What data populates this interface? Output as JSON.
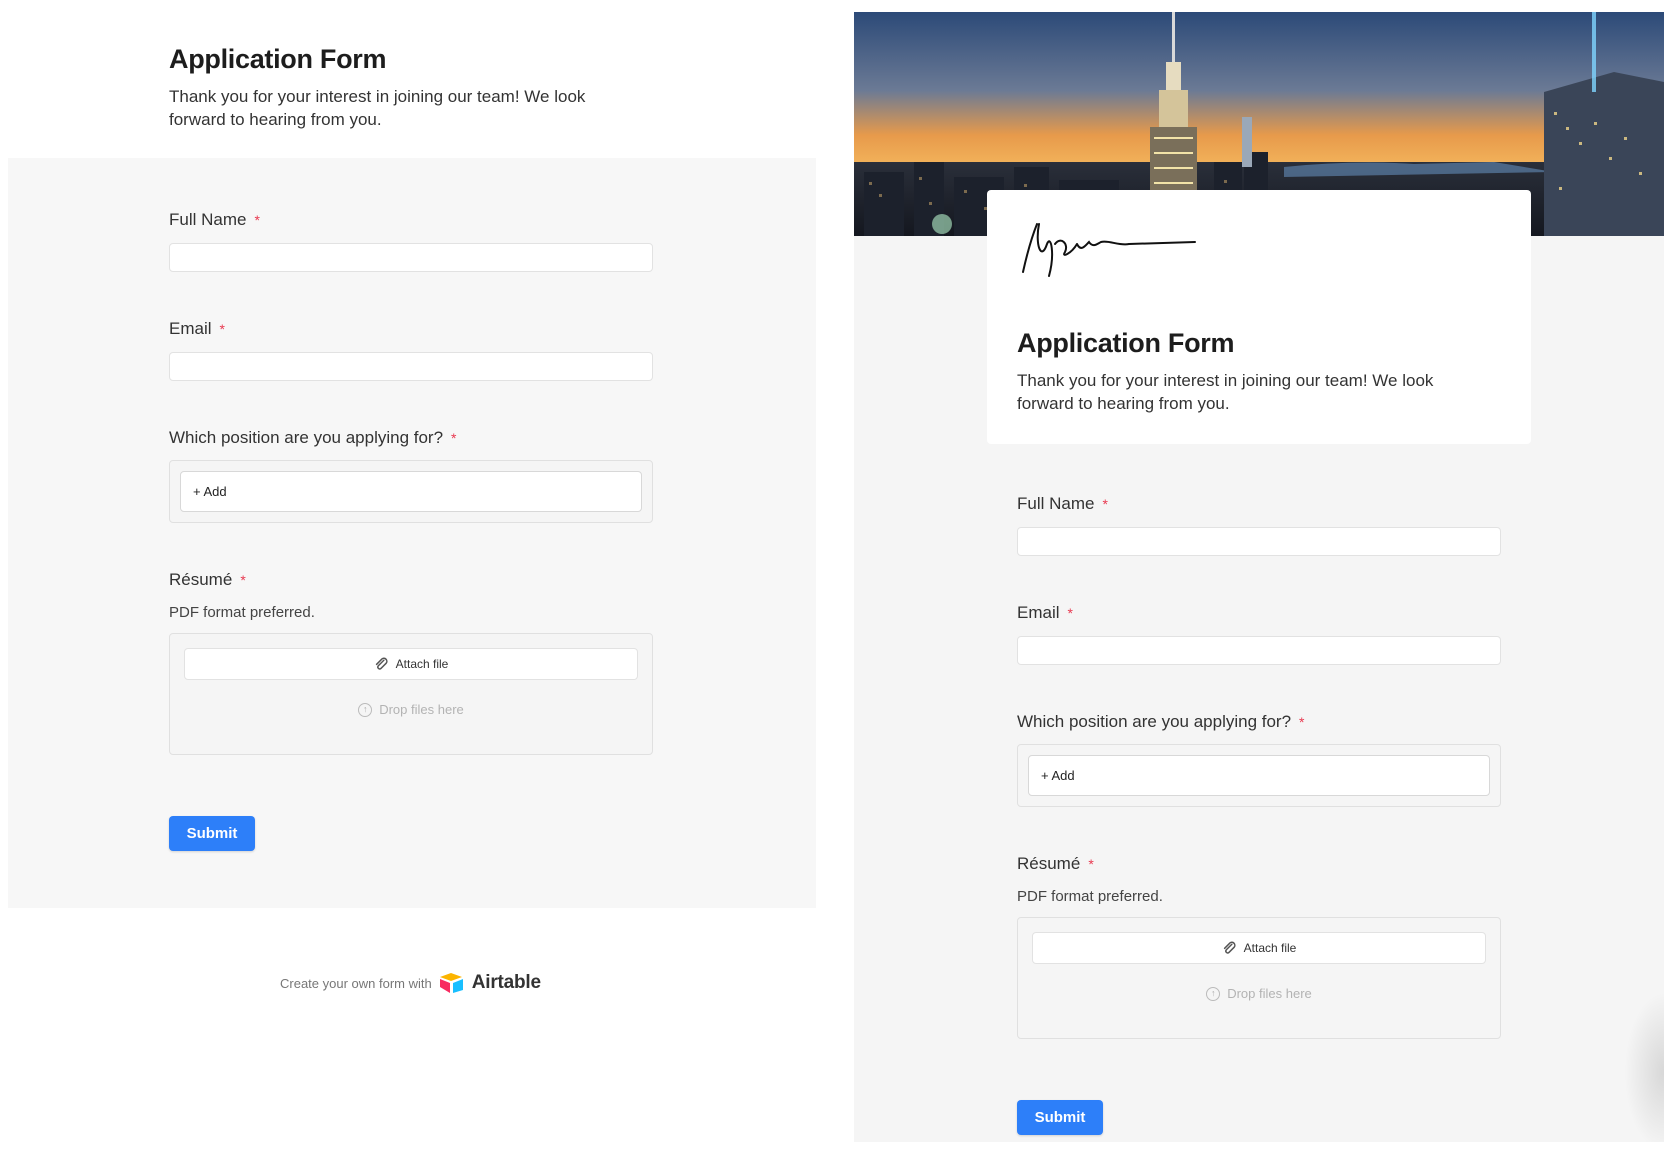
{
  "form": {
    "title": "Application Form",
    "description": "Thank you for your interest in joining our team! We look forward to hearing from you.",
    "fields": {
      "full_name": {
        "label": "Full Name",
        "required_mark": "*",
        "value": ""
      },
      "email": {
        "label": "Email",
        "required_mark": "*",
        "value": ""
      },
      "position": {
        "label": "Which position are you applying for?",
        "required_mark": "*",
        "add_label": "+ Add"
      },
      "resume": {
        "label": "Résumé",
        "required_mark": "*",
        "hint": "PDF format preferred.",
        "attach_label": "Attach file",
        "drop_label": "Drop files here"
      }
    },
    "submit_label": "Submit"
  },
  "footer": {
    "text": "Create your own form with",
    "brand": "Airtable"
  },
  "colors": {
    "accent": "#2d7ff9",
    "required": "#e8384f",
    "panel_bg": "#f7f7f7"
  },
  "icons": {
    "paperclip": "paperclip-icon",
    "upload": "upload-icon",
    "logo": "airtable-logo-icon"
  }
}
